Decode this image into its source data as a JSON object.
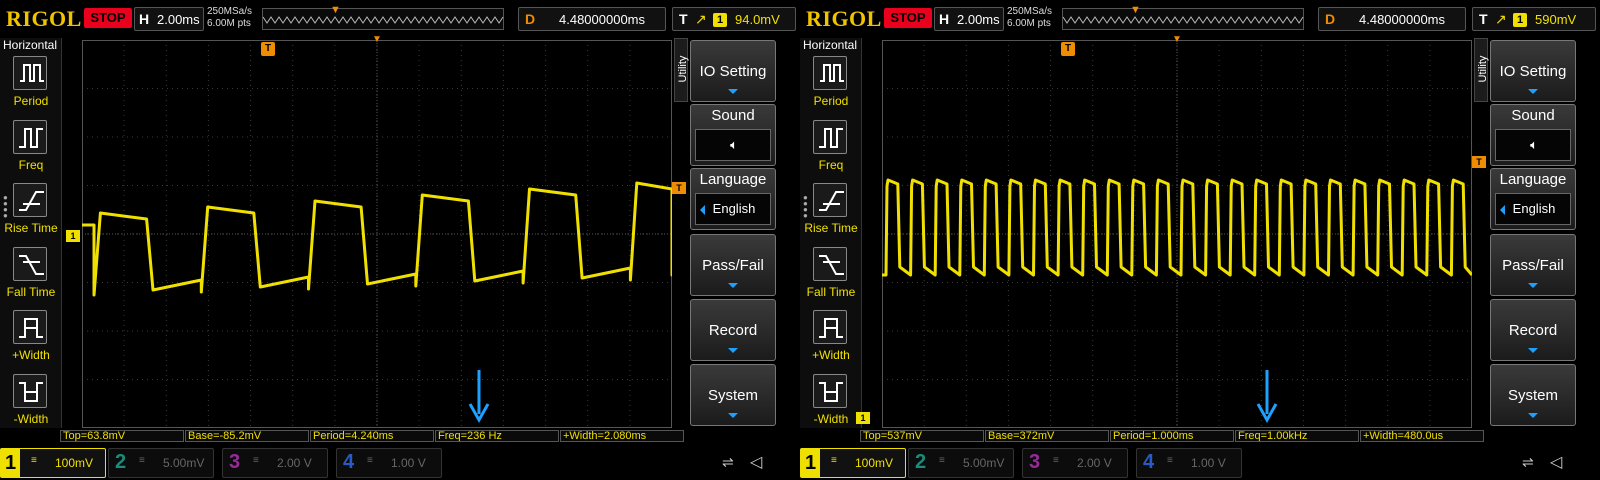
{
  "screens": [
    {
      "logo": "RIGOL",
      "run_state": "STOP",
      "horizontal": {
        "letter": "H",
        "timebase": "2.00ms"
      },
      "sample_rate": "250MSa/s",
      "memory_depth": "6.00M pts",
      "delay": {
        "letter": "D",
        "value": "4.48000000ms"
      },
      "trigger": {
        "letter": "T",
        "source": "1",
        "level": "94.0mV"
      },
      "left_menu": {
        "title": "Horizontal",
        "items": [
          {
            "label": "Period",
            "icon": "period-icon"
          },
          {
            "label": "Freq",
            "icon": "freq-icon"
          },
          {
            "label": "Rise Time",
            "icon": "rise-time-icon"
          },
          {
            "label": "Fall Time",
            "icon": "fall-time-icon"
          },
          {
            "label": "+Width",
            "icon": "plus-width-icon"
          },
          {
            "label": "-Width",
            "icon": "minus-width-icon"
          }
        ]
      },
      "utility_label": "Utility",
      "right_menu": {
        "io_setting": "IO Setting",
        "sound": "Sound",
        "language": "Language",
        "language_value": "English",
        "pass_fail": "Pass/Fail",
        "record": "Record",
        "system": "System"
      },
      "measurements": {
        "top": "Top=63.8mV",
        "base": "Base=-85.2mV",
        "period": "Period=4.240ms",
        "freq": "Freq=236 Hz",
        "width": "+Width=2.080ms"
      },
      "waveform": {
        "periods_shown": 5.5,
        "duty": 0.49
      },
      "channels": [
        {
          "num": "1",
          "scale": "100mV",
          "active": true,
          "color": "#f0e000"
        },
        {
          "num": "2",
          "scale": "5.00mV",
          "active": false,
          "color": "#1a8c7a"
        },
        {
          "num": "3",
          "scale": "2.00 V",
          "active": false,
          "color": "#9a2a9a"
        },
        {
          "num": "4",
          "scale": "1.00 V",
          "active": false,
          "color": "#2a5ac8"
        }
      ]
    },
    {
      "logo": "RIGOL",
      "run_state": "STOP",
      "horizontal": {
        "letter": "H",
        "timebase": "2.00ms"
      },
      "sample_rate": "250MSa/s",
      "memory_depth": "6.00M pts",
      "delay": {
        "letter": "D",
        "value": "4.48000000ms"
      },
      "trigger": {
        "letter": "T",
        "source": "1",
        "level": "590mV"
      },
      "left_menu": {
        "title": "Horizontal",
        "items": [
          {
            "label": "Period",
            "icon": "period-icon"
          },
          {
            "label": "Freq",
            "icon": "freq-icon"
          },
          {
            "label": "Rise Time",
            "icon": "rise-time-icon"
          },
          {
            "label": "Fall Time",
            "icon": "fall-time-icon"
          },
          {
            "label": "+Width",
            "icon": "plus-width-icon"
          },
          {
            "label": "-Width",
            "icon": "minus-width-icon"
          }
        ]
      },
      "utility_label": "Utility",
      "right_menu": {
        "io_setting": "IO Setting",
        "sound": "Sound",
        "language": "Language",
        "language_value": "English",
        "pass_fail": "Pass/Fail",
        "record": "Record",
        "system": "System"
      },
      "measurements": {
        "top": "Top=537mV",
        "base": "Base=372mV",
        "period": "Period=1.000ms",
        "freq": "Freq=1.00kHz",
        "width": "+Width=480.0us"
      },
      "waveform": {
        "periods_shown": 24,
        "duty": 0.48
      },
      "channels": [
        {
          "num": "1",
          "scale": "100mV",
          "active": true,
          "color": "#f0e000"
        },
        {
          "num": "2",
          "scale": "5.00mV",
          "active": false,
          "color": "#1a8c7a"
        },
        {
          "num": "3",
          "scale": "2.00 V",
          "active": false,
          "color": "#9a2a9a"
        },
        {
          "num": "4",
          "scale": "1.00 V",
          "active": false,
          "color": "#2a5ac8"
        }
      ]
    }
  ],
  "colors": {
    "trace": "#f0e000",
    "trigger": "#f08c00",
    "accent_arrow": "#1ea0ff",
    "stop_bg": "#e8001c"
  }
}
